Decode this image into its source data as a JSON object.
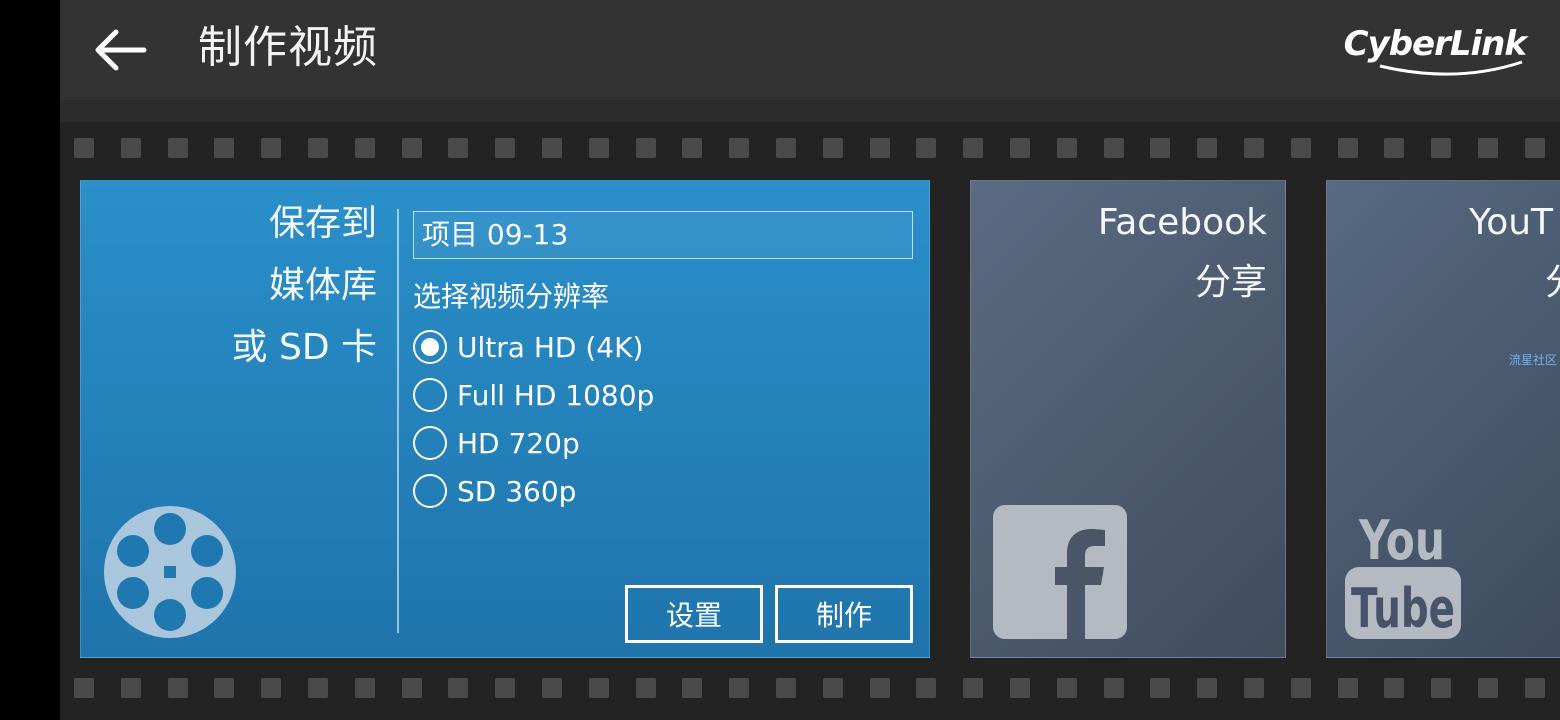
{
  "header": {
    "title": "制作视频",
    "brand": "CyberLink"
  },
  "save_card": {
    "label_lines": [
      "保存到",
      "媒体库",
      "或 SD 卡"
    ],
    "project_name": "项目 09-13",
    "resolution_heading": "选择视频分辨率",
    "options": [
      {
        "label": "Ultra HD (4K)",
        "selected": true
      },
      {
        "label": "Full HD 1080p",
        "selected": false
      },
      {
        "label": "HD 720p",
        "selected": false
      },
      {
        "label": "SD 360p",
        "selected": false
      }
    ],
    "settings_label": "设置",
    "make_label": "制作",
    "icon": "film-reel-icon"
  },
  "facebook_card": {
    "title": "Facebook",
    "subtitle": "分享",
    "icon": "facebook-icon"
  },
  "youtube_card": {
    "title": "YouT",
    "subtitle": "分",
    "watermark": "流星社区",
    "icon": "youtube-icon"
  },
  "colors": {
    "header_bg": "#333333",
    "save_card": "#2a8fca",
    "social_card": "#4d5a6e"
  }
}
